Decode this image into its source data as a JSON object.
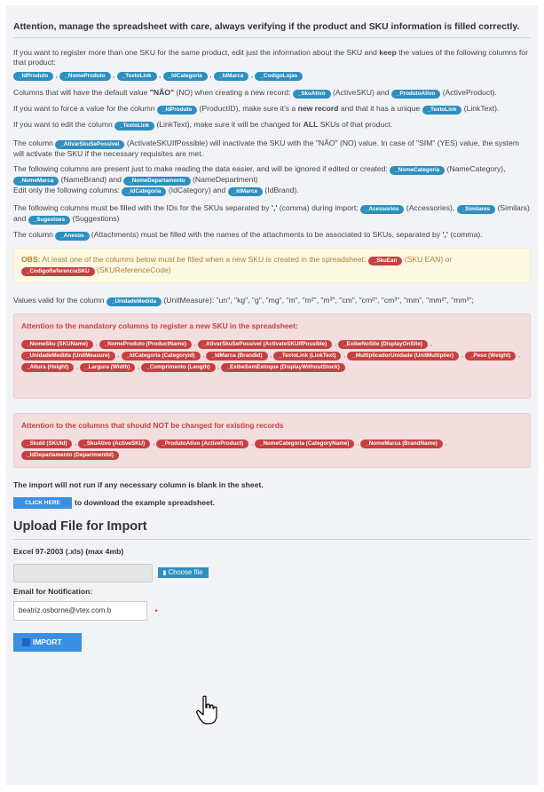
{
  "header": {
    "title": "Attention, manage the spreadsheet with care, always verifying if the product and SKU information is filled correctly."
  },
  "paragraphs": {
    "p1_pre": "If you want to register more than one SKU for the same product, edit just the information about the SKU and ",
    "p1_bold": "keep",
    "p1_post": " the values of the following columns for that product:",
    "keep_badges": [
      "_IdProduto",
      "_NomeProduto",
      "_TextoLink",
      "_IdCategoria",
      "_IdMarca",
      "_CodigoLojas"
    ],
    "p2_pre": "Columns that will have the default value ",
    "p2_bold": "\"NÃO\"",
    "p2_mid": " (NO) when creating a new record: ",
    "p2_badge1": "_SkuAtivo",
    "p2_mid2": " (ActiveSKU) and ",
    "p2_badge2": "_ProdutoAtivo",
    "p2_post": " (ActiveProduct).",
    "p3_pre": "If you want to force a value for the column ",
    "p3_badge1": "_IdProduto",
    "p3_mid": " (ProductID), make sure it's a ",
    "p3_bold": "new record",
    "p3_mid2": " and that it has a unique ",
    "p3_badge2": "_TextoLink",
    "p3_post": " (LinkText).",
    "p4_pre": "If you want to edit the column ",
    "p4_badge": "_TextoLink",
    "p4_mid": " (LinkText), make sure it will be changed for ",
    "p4_bold": "ALL",
    "p4_post": " SKUs of that product.",
    "p5_pre": "The column ",
    "p5_badge": "_AtivarSkuSePossivel",
    "p5_post": " (ActivateSKUIfPossible) will inactivate the SKU with the \"NÃO\" (NO) value. In case of \"SIM\" (YES) value, the system will activate the SKU if the necessary requisites are met.",
    "p6_pre": "The following columns are present just to make reading the data easier, and will be ignored if edited or created: ",
    "p6_badge1": "_NomeCategoria",
    "p6_mid1": " (NameCategory), ",
    "p6_badge2": "_NomeMarca",
    "p6_mid2": " (NameBrand) and ",
    "p6_badge3": "_NomeDepartamento",
    "p6_mid3": " (NameDepartment)",
    "p6b_pre": "Edit only the following columns: ",
    "p6b_badge1": "_IdCategoria",
    "p6b_mid": " (IdCategory) and ",
    "p6b_badge2": "_IdMarca",
    "p6b_post": " (IdBrand).",
    "p7_pre": "The following columns must be filled with the IDs for the SKUs separated by ",
    "p7_bold": "','",
    "p7_mid1": " (comma) during import: ",
    "p7_badge1": "_Acessorios",
    "p7_mid2": " (Accessories), ",
    "p7_badge2": "_Similares",
    "p7_mid3": " (Similars) and ",
    "p7_badge3": "_Sugestoes",
    "p7_post": " (Suggestions)",
    "p8_pre": "The column ",
    "p8_badge": "_Anexos",
    "p8_mid": " (Attachments) must be filled with the names of the attachments to be associated to SKUs, separated by ",
    "p8_bold": "','",
    "p8_post": " (comma).",
    "p9_pre": "Values valid for the column ",
    "p9_badge": "_UnidadeMedida",
    "p9_post": " (UnitMeasure): \"un\", \"kg\", \"g\", \"mg\", \"m\", \"m²\", \"m³\", \"cm\", \"cm²\", \"cm³\", \"mm\", \"mm²\", \"mm³\";"
  },
  "obs": {
    "label": "OBS:",
    "text_pre": " At least one of the columns below must be filled when a new SKU is created in the spreadsheet: ",
    "badge1": "_SkuEan",
    "mid": " (SKU EAN) or ",
    "badge2": "_CodigoReferenciaSKU",
    "post": " (SKUReferenceCode)"
  },
  "mandatory": {
    "title": "Attention to the mandatory columns to register a new SKU in the spreadsheet:",
    "badges": [
      "_NomeSku (SKUName)",
      "_NomeProduto (ProductName)",
      "_AtivarSkuSePossível (ActivateSKUIfPossible)",
      "_ExibeNoSite (DisplayOnSite)",
      "_UnidadeMedida (UnitMeasure)",
      "_IdCategoria (Categoryid)",
      "_IdMarca (Brandid)",
      "_TextoLink (LinkText)",
      "_MultiplicadorUnidade (UnitMultiplier)",
      "_Peso (Weight)",
      "_Altura (Height)",
      "_Largura (Width)",
      "_Comprimento (Length)",
      "_ExibeSemEstoque (DisplayWithoutStock)"
    ]
  },
  "not_changed": {
    "title": "Attention to the columns that should NOT be changed for existing records",
    "badges": [
      "_SkuId (SKUId)",
      "_SkuAtivo (ActiveSKU)",
      "_ProdutoAtivo (ActiveProduct)",
      "_NomeCategoria (CategoryName)",
      "_NomeMarca (BrandName)",
      "_IdDepartamento (DepartmentId)"
    ]
  },
  "footer_note": "The import will not run if any necessary column is blank in the sheet.",
  "download": {
    "button_label": "CLICK HERE",
    "text": "to download the example spreadsheet."
  },
  "upload": {
    "title": "Upload File for Import",
    "file_label": "Excel 97-2003 (.xls) (max 4mb)",
    "choose_label": "Choose file",
    "email_label": "Email for Notification:",
    "email_value": "beatriz.osborne@vtex.com.b",
    "required_mark": "•",
    "import_label": "IMPORT"
  },
  "colors": {
    "badge_blue": "#2e8fbf",
    "badge_red": "#c74040",
    "button_blue": "#3a8fe0"
  },
  "icons": [
    "folder-open-icon",
    "hand-pointer-cursor-icon",
    "import-square-icon"
  ]
}
